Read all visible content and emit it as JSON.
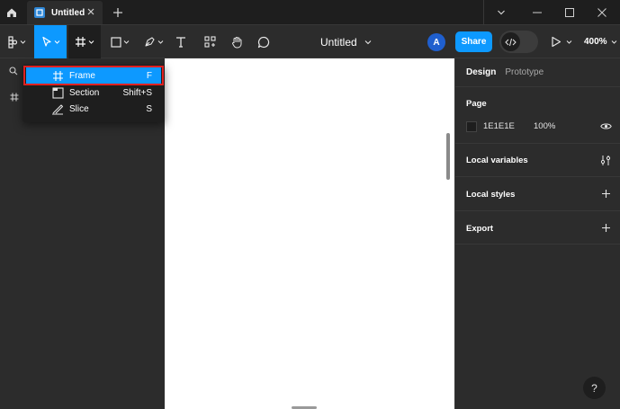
{
  "titlebar": {
    "tab_label": "Untitled",
    "home_icon": "home-icon",
    "close_icon": "close-icon",
    "new_tab_icon": "plus-icon",
    "window_controls": [
      "chevron-down-icon",
      "minimize-icon",
      "maximize-icon",
      "close-icon"
    ]
  },
  "toolbar": {
    "doc_title": "Untitled",
    "avatar_initial": "A",
    "share_label": "Share",
    "zoom_label": "400%",
    "tools": [
      "main-menu-icon",
      "move-icon",
      "frame-icon",
      "shape-icon",
      "pen-icon",
      "text-icon",
      "resources-icon",
      "hand-icon",
      "comment-icon"
    ]
  },
  "menu": {
    "items": [
      {
        "label": "Frame",
        "shortcut": "F",
        "icon": "frame-icon"
      },
      {
        "label": "Section",
        "shortcut": "Shift+S",
        "icon": "section-icon"
      },
      {
        "label": "Slice",
        "shortcut": "S",
        "icon": "slice-icon"
      }
    ]
  },
  "rightpanel": {
    "tabs": [
      "Design",
      "Prototype"
    ],
    "page_title": "Page",
    "page_color": "1E1E1E",
    "page_opacity": "100%",
    "local_variables": "Local variables",
    "local_styles": "Local styles",
    "export": "Export",
    "help": "?"
  },
  "colors": {
    "accent": "#0d99ff",
    "highlight_border": "#e02020",
    "panel": "#2c2c2c",
    "dark": "#1e1e1e"
  }
}
